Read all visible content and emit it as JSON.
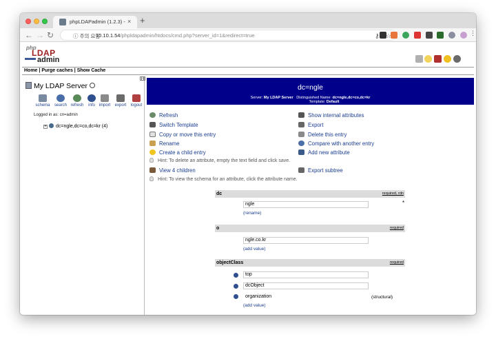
{
  "browser": {
    "tab_title": "phpLDAPadmin (1.2.3) -",
    "tab_close": "×",
    "new_tab": "+",
    "address_warning": "ⓘ 주의 요함",
    "address_host": "10.10.1.54",
    "address_path": "/phpldapadmin/htdocs/cmd.php?server_id=1&redirect=true"
  },
  "header": {
    "logo_php": "php",
    "logo_ldap": "LDAP",
    "logo_admin": "admin",
    "menu": [
      "Home",
      "Purge caches",
      "Show Cache"
    ],
    "menu_sep": " | "
  },
  "left": {
    "server_name": "My LDAP Server",
    "buttons": [
      "schema",
      "search",
      "refresh",
      "info",
      "import",
      "export",
      "logout"
    ],
    "logged_in_label": "Logged in as:",
    "logged_in_user": "cn=admin",
    "tree_plus": "+",
    "tree_entry": "dc=ngle,dc=co,dc=kr (4)"
  },
  "entry": {
    "dn_title": "dc=ngle",
    "server_label": "Server:",
    "server_value": "My LDAP Server",
    "dn_label": "Distinguished Name:",
    "dn_value": "dc=ngle,dc=co,dc=kr",
    "template_label": "Template:",
    "template_value": "Default"
  },
  "actions_left": [
    "Refresh",
    "Switch Template",
    "Copy or move this entry",
    "Rename",
    "Create a child entry"
  ],
  "actions_right": [
    "Show internal attributes",
    "Export",
    "Delete this entry",
    "Compare with another entry",
    "Add new attribute"
  ],
  "hint1": "Hint: To delete an attribute, empty the text field and click save.",
  "view_children": "View 4 children",
  "export_subtree": "Export subtree",
  "hint2": "Hint: To view the schema for an attribute, click the attribute name.",
  "attributes": {
    "dc": {
      "name": "dc",
      "tag": "required, rdn",
      "value": "ngle",
      "link": "(rename)",
      "star": "*"
    },
    "o": {
      "name": "o",
      "tag": "required",
      "value": "ngle.co.kr",
      "link": "(add value)"
    },
    "objectClass": {
      "name": "objectClass",
      "tag": "required",
      "values": [
        "top",
        "dcObject",
        "organization"
      ],
      "structural": "(structural)",
      "link": "(add value)"
    }
  },
  "colors": {
    "dn_bar": "#00008b",
    "link": "#1a3d8f",
    "attr_header": "#dcdcdc"
  }
}
